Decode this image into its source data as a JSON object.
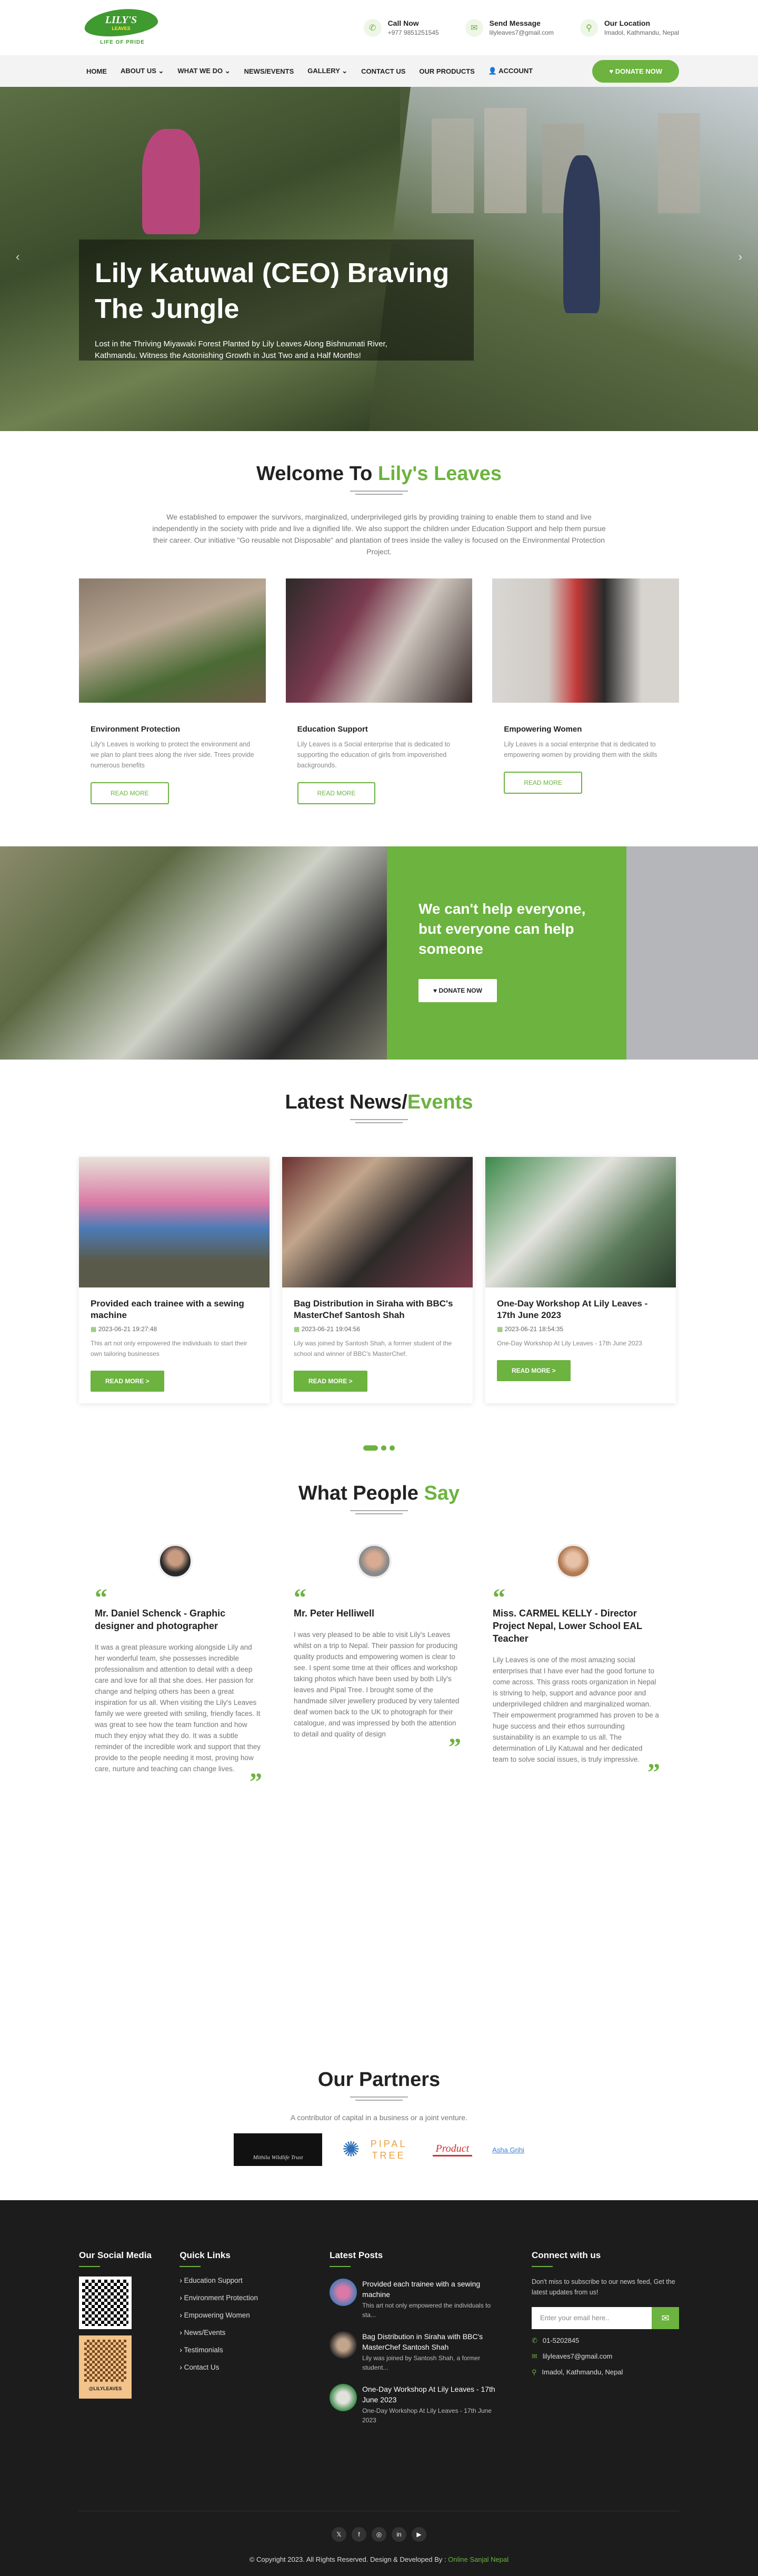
{
  "logo": {
    "text": "LILY'S",
    "sub": "LEAVES",
    "tagline": "LIFE OF PRIDE"
  },
  "contacts": [
    {
      "icon": "phone-icon",
      "title": "Call Now",
      "value": "+977 9851251545"
    },
    {
      "icon": "mail-icon",
      "title": "Send Message",
      "value": "lilyleaves7@gmail.com"
    },
    {
      "icon": "location-icon",
      "title": "Our Location",
      "value": "Imadol, Kathmandu, Nepal"
    }
  ],
  "nav": {
    "items": [
      "HOME",
      "ABOUT US ⌄",
      "WHAT WE DO ⌄",
      "NEWS/EVENTS",
      "GALLERY ⌄",
      "CONTACT US",
      "OUR PRODUCTS",
      "👤 ACCOUNT"
    ],
    "donate": "♥ DONATE NOW"
  },
  "hero": {
    "title": "Lily Katuwal (CEO) Braving The Jungle",
    "text": "Lost in the Thriving Miyawaki Forest Planted by Lily Leaves Along Bishnumati River, Kathmandu. Witness the Astonishing Growth in Just Two and a Half Months!",
    "prev": "‹",
    "next": "›"
  },
  "welcome": {
    "title_a": "Welcome To ",
    "title_b": "Lily's Leaves",
    "text": "We established to empower the survivors, marginalized, underprivileged girls by providing training to enable them to stand and live independently in the society with pride and live a dignified life. We also support the children under Education Support and help them pursue their career. Our initiative \"Go reusable not Disposable\" and plantation of trees inside the valley is focused on the Environmental Protection Project.",
    "cards": [
      {
        "title": "Environment Protection",
        "text": "Lily's Leaves is working to protect the environment and we plan to plant trees along the river side. Trees provide numerous benefits",
        "button": "READ MORE"
      },
      {
        "title": "Education Support",
        "text": "Lily Leaves is a Social enterprise that is dedicated to supporting the education of girls from impoverished backgrounds.",
        "button": "READ MORE"
      },
      {
        "title": "Empowering Women",
        "text": "Lily Leaves is a social enterprise that is dedicated to empowering women by providing them with the skills",
        "button": "READ MORE"
      }
    ]
  },
  "cta": {
    "title": "We can't help everyone, but everyone can help someone",
    "button": "♥ DONATE NOW"
  },
  "news": {
    "title_a": "Latest News/",
    "title_b": "Events",
    "items": [
      {
        "title": "Provided each trainee with a sewing machine",
        "date": "2023-06-21 19:27:48",
        "text": "This art not only empowered the individuals to start their own tailoring businesses",
        "button": "READ MORE >"
      },
      {
        "title": "Bag Distribution in Siraha with BBC's MasterChef Santosh Shah",
        "date": "2023-06-21 19:04:56",
        "text": "Lily was joined by Santosh Shah, a former student of the school and winner of BBC's MasterChef.",
        "button": "READ MORE >"
      },
      {
        "title": "One-Day Workshop At Lily Leaves - 17th June 2023",
        "date": "2023-06-21 18:54:35",
        "text": "One-Day Workshop At Lily Leaves - 17th June 2023",
        "button": "READ MORE >"
      }
    ]
  },
  "testimonials": {
    "title_a": "What People ",
    "title_b": "Say",
    "items": [
      {
        "name": "Mr. Daniel Schenck - Graphic designer and photographer",
        "text": "It was a great pleasure working alongside Lily and her wonderful team, she possesses incredible professionalism and attention to detail with a deep care and love for all that she does. Her passion for change and helping others has been a great inspiration for us all. When visiting the Lily's Leaves family we were greeted with smiling, friendly faces. It was great to see how the team function and how much they enjoy what they do. It was a subtle reminder of the incredible work and support that they provide to the people needing it most, proving how care, nurture and teaching can change lives."
      },
      {
        "name": "Mr. Peter Helliwell",
        "text": "I was very pleased to be able to visit Lily's Leaves whilst on a trip to Nepal. Their passion for producing quality products and empowering women is clear to see. I spent some time at their offices and workshop taking photos which have been used by both Lily's leaves and Pipal Tree. I brought some of the handmade silver jewellery produced by very talented deaf women back to the UK to photograph for their catalogue, and was impressed by both the attention to detail and quality of design"
      },
      {
        "name": "Miss. CARMEL KELLY - Director Project Nepal, Lower School EAL Teacher",
        "text": "Lily Leaves is one of the most amazing social enterprises that I have ever had the good fortune to come across. This grass roots organization in Nepal is striving to help, support and advance poor and underprivileged children and marginalized woman. Their empowerment programmed has proven to be a huge success and their ethos surrounding sustainability is an example to us all. The determination of Lily Katuwal and her dedicated team to solve social issues, is truly impressive."
      }
    ]
  },
  "partners": {
    "title": "Our Partners",
    "sub": "A contributor of capital in a business or a joint venture.",
    "logos": [
      "Mithila Wildlife Trust",
      "PIPAL TREE",
      "Product",
      "Asha Grihi"
    ]
  },
  "footer": {
    "social_title": "Our Social Media",
    "qr_label": "@LILYLEAVES",
    "links_title": "Quick Links",
    "links": [
      "Education Support",
      "Environment Protection",
      "Empowering Women",
      "News/Events",
      "Testimonials",
      "Contact Us"
    ],
    "posts_title": "Latest Posts",
    "posts": [
      {
        "title": "Provided each trainee with a sewing machine",
        "text": "This art not only empowered the individuals to sta..."
      },
      {
        "title": "Bag Distribution in Siraha with BBC's MasterChef Santosh Shah",
        "text": "Lily was joined by Santosh Shah, a former student..."
      },
      {
        "title": "One-Day Workshop At Lily Leaves - 17th June 2023",
        "text": "One-Day Workshop At Lily Leaves - 17th June 2023"
      }
    ],
    "connect_title": "Connect with us",
    "connect_text": "Don't miss to subscribe to our news feed, Get the latest updates from us!",
    "email_placeholder": "Enter your email here..",
    "phone": "01-5202845",
    "email": "lilyleaves7@gmail.com",
    "location": "Imadol, Kathmandu, Nepal",
    "socials": [
      "𝕏",
      "f",
      "◎",
      "in",
      "▶"
    ],
    "copyright": "© Copyright 2023. All Rights Reserved. Design & Developed By : ",
    "developer": "Online Sanjal Nepal"
  }
}
